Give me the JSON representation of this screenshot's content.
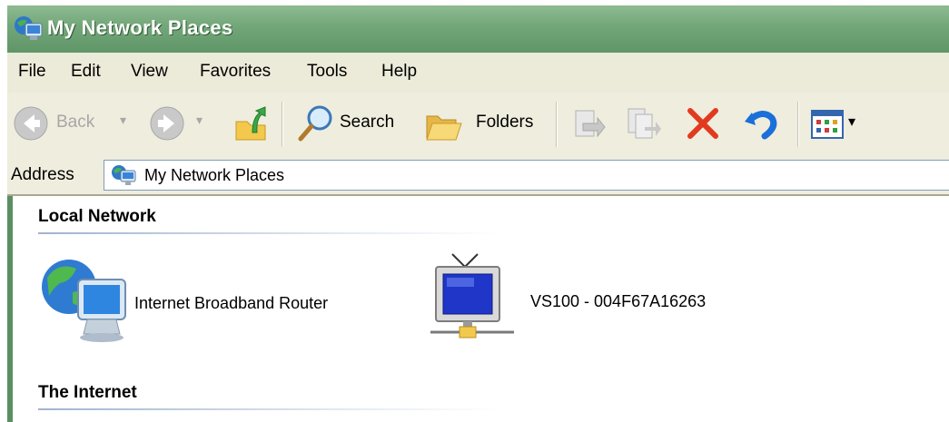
{
  "window": {
    "title": "My Network Places"
  },
  "menu": {
    "items": [
      {
        "label": "File"
      },
      {
        "label": "Edit"
      },
      {
        "label": "View"
      },
      {
        "label": "Favorites"
      },
      {
        "label": "Tools"
      },
      {
        "label": "Help"
      }
    ]
  },
  "toolbar": {
    "back_label": "Back",
    "search_label": "Search",
    "folders_label": "Folders",
    "icons": [
      "back-icon",
      "forward-icon",
      "up-folder-icon",
      "search-icon",
      "folders-icon",
      "move-to-icon",
      "copy-to-icon",
      "delete-icon",
      "undo-icon",
      "views-icon"
    ]
  },
  "address": {
    "label": "Address",
    "value": "My Network Places"
  },
  "groups": [
    {
      "header": "Local Network",
      "items": [
        {
          "label": "Internet Broadband Router",
          "icon": "network-computer-icon"
        },
        {
          "label": "VS100 - 004F67A16263",
          "icon": "network-tv-device-icon"
        }
      ]
    },
    {
      "header": "The Internet",
      "items": []
    }
  ],
  "colors": {
    "titlebar": "#74a87a",
    "menubar": "#ecead9",
    "delete_red": "#e23a1f",
    "undo_blue": "#1a6fd8"
  }
}
